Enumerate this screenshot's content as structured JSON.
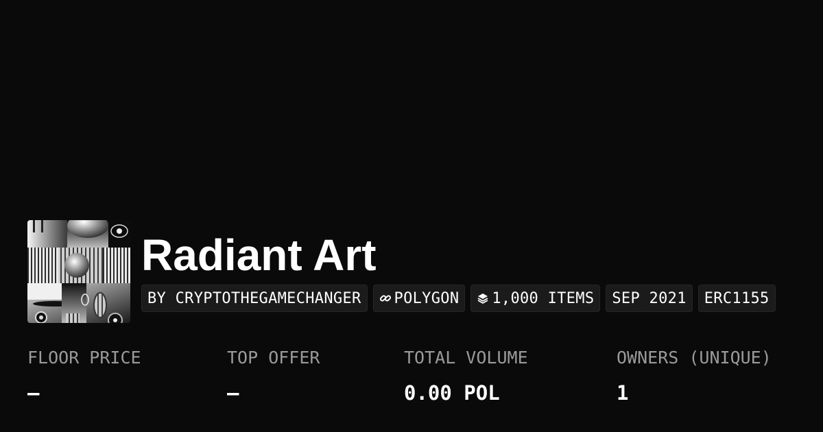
{
  "collection": {
    "name": "Radiant Art",
    "tags": {
      "creator": "BY CRYPTOTHEGAMECHANGER",
      "chain": "POLYGON",
      "chain_icon": "chain-link-icon",
      "items": "1,000 ITEMS",
      "items_icon": "layers-icon",
      "date": "SEP 2021",
      "standard": "ERC1155"
    }
  },
  "stats": {
    "floor_price": {
      "label": "FLOOR PRICE",
      "value": "–"
    },
    "top_offer": {
      "label": "TOP OFFER",
      "value": "–"
    },
    "total_volume": {
      "label": "TOTAL VOLUME",
      "value": "0.00 POL"
    },
    "owners": {
      "label": "OWNERS (UNIQUE)",
      "value": "1"
    }
  },
  "colors": {
    "background": "#0a0a0a",
    "text": "#ffffff",
    "muted": "#9a9a9a",
    "tag_bg": "#1b1b1b"
  }
}
